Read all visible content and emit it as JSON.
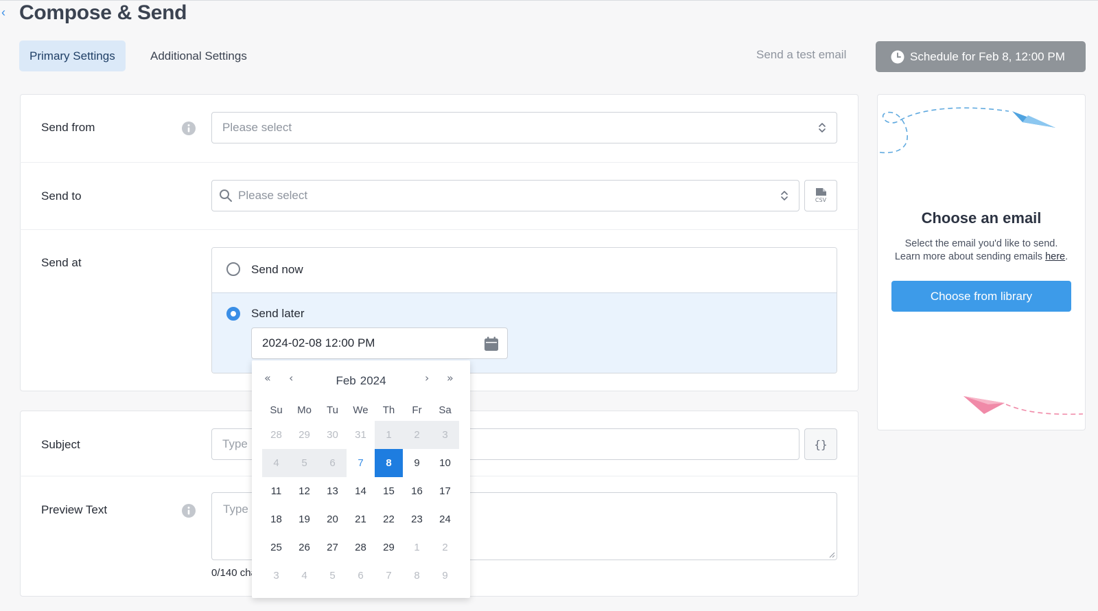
{
  "header": {
    "back_icon": "chevron-left-icon",
    "title": "Compose & Send"
  },
  "tabs": [
    {
      "label": "Primary Settings",
      "active": true
    },
    {
      "label": "Additional Settings",
      "active": false
    }
  ],
  "actions": {
    "test_email": "Send a test email",
    "schedule_label": "Schedule for Feb 8, 12:00 PM",
    "schedule_icon": "clock-icon"
  },
  "form": {
    "send_from": {
      "label": "Send from",
      "placeholder": "Please select"
    },
    "send_to": {
      "label": "Send to",
      "placeholder": "Please select",
      "csv_icon": "csv-file-icon"
    },
    "send_at": {
      "label": "Send at",
      "options": [
        {
          "label": "Send now",
          "selected": false
        },
        {
          "label": "Send later",
          "selected": true
        }
      ],
      "datetime_value": "2024-02-08 12:00 PM"
    },
    "subject": {
      "label": "Subject",
      "placeholder": "Type",
      "braces": "{}"
    },
    "preview_text": {
      "label": "Preview Text",
      "placeholder": "Type",
      "char_count": "0/140 characters"
    }
  },
  "calendar": {
    "month": "Feb",
    "year": "2024",
    "weekdays": [
      "Su",
      "Mo",
      "Tu",
      "We",
      "Th",
      "Fr",
      "Sa"
    ],
    "weeks": [
      [
        "28",
        "29",
        "30",
        "31",
        "1",
        "2",
        "3"
      ],
      [
        "4",
        "5",
        "6",
        "7",
        "8",
        "9",
        "10"
      ],
      [
        "11",
        "12",
        "13",
        "14",
        "15",
        "16",
        "17"
      ],
      [
        "18",
        "19",
        "20",
        "21",
        "22",
        "23",
        "24"
      ],
      [
        "25",
        "26",
        "27",
        "28",
        "29",
        "1",
        "2"
      ],
      [
        "3",
        "4",
        "5",
        "6",
        "7",
        "8",
        "9"
      ]
    ],
    "selected_day": "8",
    "today_day": "7"
  },
  "side_panel": {
    "title": "Choose an email",
    "description_line1": "Select the email you'd like to send.",
    "description_line2": "Learn more about sending emails",
    "link_text": "here",
    "link_suffix": ".",
    "button_label": "Choose from library"
  },
  "colors": {
    "accent": "#3a8ee6",
    "selected_day": "#1e7de0",
    "schedule_button": "#8f9499",
    "library_button": "#3d9be9",
    "active_tab_bg": "#dbe9f8"
  }
}
